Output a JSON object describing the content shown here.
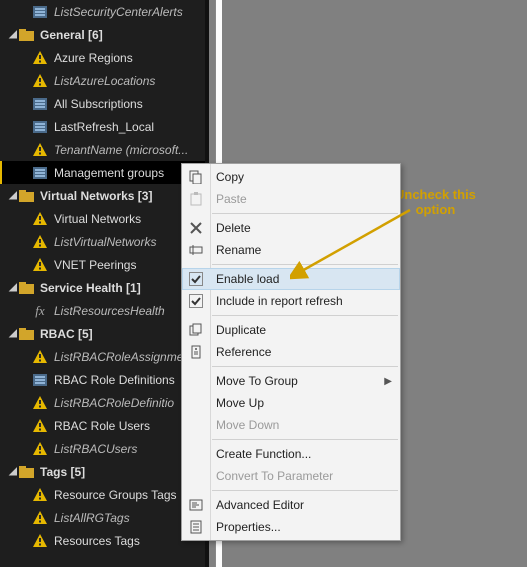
{
  "tree": {
    "top_item": "ListSecurityCenterAlerts",
    "folders": [
      {
        "label": "General [6]",
        "items": [
          {
            "label": "Azure Regions",
            "icon": "warn"
          },
          {
            "label": "ListAzureLocations",
            "icon": "warn",
            "italic": true
          },
          {
            "label": "All Subscriptions",
            "icon": "table"
          },
          {
            "label": "LastRefresh_Local",
            "icon": "table"
          },
          {
            "label": "TenantName (microsoft...",
            "icon": "warn",
            "italic": true
          },
          {
            "label": "Management groups",
            "icon": "table",
            "selected": true
          }
        ]
      },
      {
        "label": "Virtual Networks [3]",
        "items": [
          {
            "label": "Virtual Networks",
            "icon": "warn"
          },
          {
            "label": "ListVirtualNetworks",
            "icon": "warn",
            "italic": true
          },
          {
            "label": "VNET Peerings",
            "icon": "warn"
          }
        ]
      },
      {
        "label": "Service Health [1]",
        "items": [
          {
            "label": "ListResourcesHealth",
            "icon": "fx",
            "italic": true
          }
        ]
      },
      {
        "label": "RBAC [5]",
        "items": [
          {
            "label": "ListRBACRoleAssignme",
            "icon": "warn",
            "italic": true
          },
          {
            "label": "RBAC Role Definitions",
            "icon": "table"
          },
          {
            "label": "ListRBACRoleDefinitio",
            "icon": "warn",
            "italic": true
          },
          {
            "label": "RBAC Role Users",
            "icon": "warn"
          },
          {
            "label": "ListRBACUsers",
            "icon": "warn",
            "italic": true
          }
        ]
      },
      {
        "label": "Tags [5]",
        "items": [
          {
            "label": "Resource Groups Tags",
            "icon": "warn"
          },
          {
            "label": "ListAllRGTags",
            "icon": "warn",
            "italic": true
          },
          {
            "label": "Resources Tags",
            "icon": "warn"
          }
        ]
      }
    ]
  },
  "context_menu": [
    {
      "label": "Copy",
      "icon": "copy"
    },
    {
      "label": "Paste",
      "icon": "paste",
      "disabled": true
    },
    {
      "sep": true
    },
    {
      "label": "Delete",
      "icon": "delete"
    },
    {
      "label": "Rename",
      "icon": "rename"
    },
    {
      "sep": true
    },
    {
      "label": "Enable load",
      "icon": "check",
      "checked": true,
      "hover": true
    },
    {
      "label": "Include in report refresh",
      "icon": "check",
      "checked": true
    },
    {
      "sep": true
    },
    {
      "label": "Duplicate",
      "icon": "duplicate"
    },
    {
      "label": "Reference",
      "icon": "reference"
    },
    {
      "sep": true
    },
    {
      "label": "Move To Group",
      "submenu": true
    },
    {
      "label": "Move Up"
    },
    {
      "label": "Move Down",
      "disabled": true
    },
    {
      "sep": true
    },
    {
      "label": "Create Function..."
    },
    {
      "label": "Convert To Parameter",
      "disabled": true
    },
    {
      "sep": true
    },
    {
      "label": "Advanced Editor",
      "icon": "editor"
    },
    {
      "label": "Properties...",
      "icon": "properties"
    }
  ],
  "annotation": {
    "line1": "Uncheck this",
    "line2": "option"
  }
}
